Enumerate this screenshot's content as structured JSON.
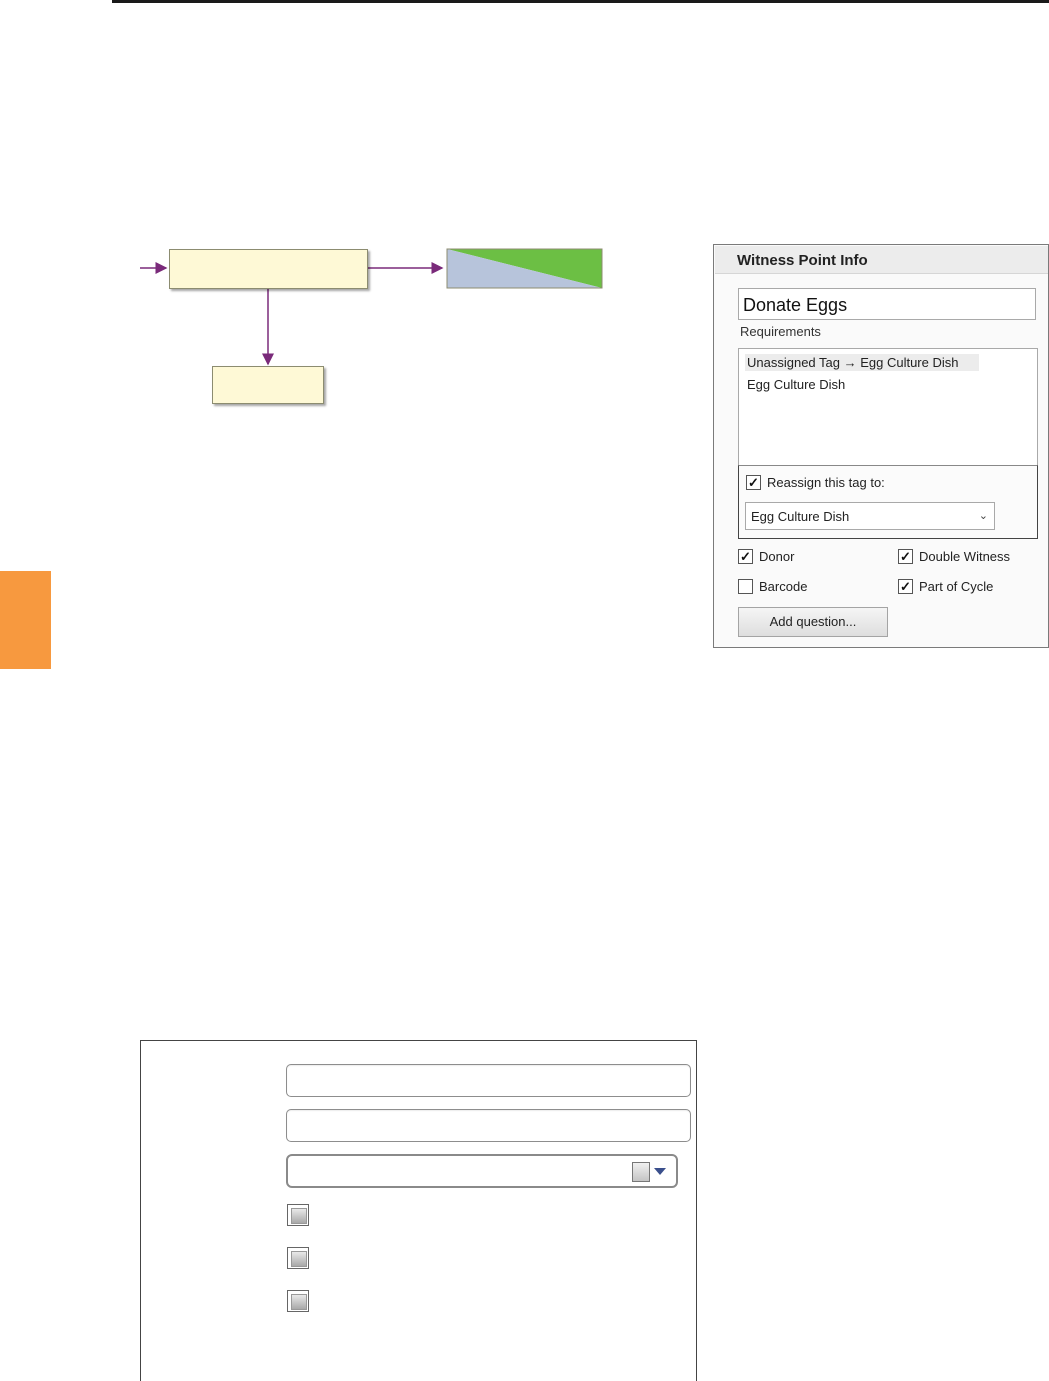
{
  "colors": {
    "accent_tab": "#f7993f",
    "box_fill": "#fef9d6",
    "arrow": "#7a2a7a",
    "status_blue": "#b7c4db",
    "status_green": "#6cbf44"
  },
  "witness_panel": {
    "title": "Witness Point Info",
    "name_value": "Donate Eggs",
    "requirements_label": "Requirements",
    "requirements": [
      "Unassigned Tag → Egg Culture Dish",
      "Egg Culture Dish"
    ],
    "reassign_label": "Reassign this tag to:",
    "reassign_checked": true,
    "reassign_select_value": "Egg Culture Dish",
    "options": [
      {
        "label": "Donor",
        "checked": true
      },
      {
        "label": "Double Witness",
        "checked": true
      },
      {
        "label": "Barcode",
        "checked": false
      },
      {
        "label": "Part of Cycle",
        "checked": true
      }
    ],
    "add_question_label": "Add question..."
  },
  "form_panel": {
    "checkboxes": [
      false,
      false,
      false
    ]
  },
  "icons": {
    "dropdown": "chevron-down-icon",
    "document": "document-icon",
    "check": "check-icon"
  }
}
